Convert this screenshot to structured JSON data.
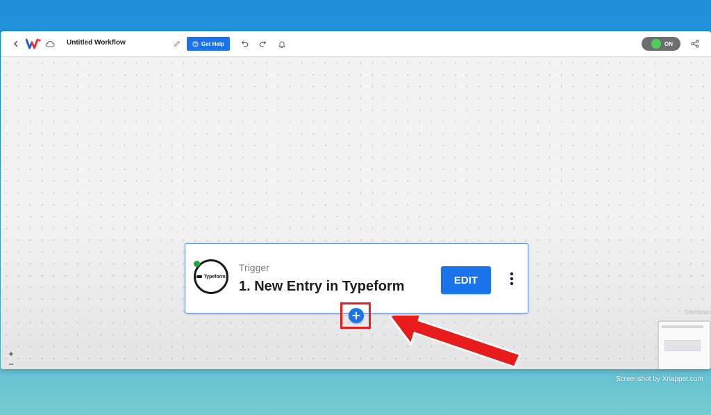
{
  "toolbar": {
    "workflow_title": "Untitled Workflow",
    "help_label": "Get Help",
    "toggle_label": "ON"
  },
  "trigger_card": {
    "label": "Trigger",
    "title": "1. New Entry in Typeform",
    "app_icon_text": "Typeform",
    "edit_label": "EDIT"
  },
  "minimap": {
    "label": "Dashboard"
  },
  "watermark": "Screenshot by Xnapper.com",
  "colors": {
    "accent": "#1a73e8",
    "status_on": "#4cd05a",
    "annotation_red": "#e81c1c"
  },
  "icons": {
    "back": "chevron-left-icon",
    "logo": "w-logo-icon",
    "cloud": "cloud-icon",
    "pencil": "pencil-icon",
    "help": "help-circle-icon",
    "undo": "undo-icon",
    "redo": "redo-icon",
    "bell": "bell-icon",
    "share": "share-icon",
    "more": "more-vertical-icon",
    "add": "plus-icon"
  }
}
